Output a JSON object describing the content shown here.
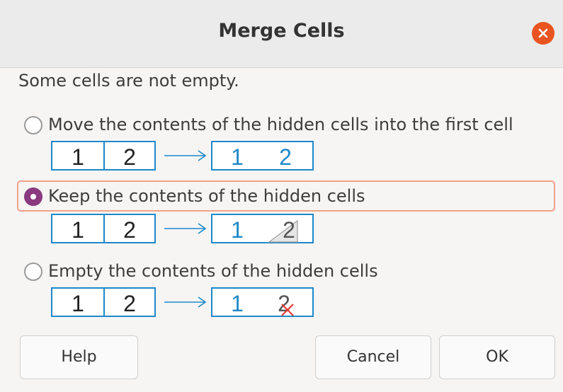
{
  "window": {
    "title": "Merge Cells",
    "close_icon": "close-icon"
  },
  "message": "Some cells are not empty.",
  "options": [
    {
      "label": "Move the contents of the hidden cells into the first cell",
      "checked": false,
      "diagram": {
        "left": [
          "1",
          "2"
        ],
        "right": [
          "1",
          "2"
        ],
        "style": "move"
      }
    },
    {
      "label": "Keep the contents of the hidden cells",
      "checked": true,
      "diagram": {
        "left": [
          "1",
          "2"
        ],
        "right": [
          "1",
          "2"
        ],
        "style": "keep"
      }
    },
    {
      "label": "Empty the contents of the hidden cells",
      "checked": false,
      "diagram": {
        "left": [
          "1",
          "2"
        ],
        "right": [
          "1",
          "2"
        ],
        "style": "empty"
      }
    }
  ],
  "buttons": {
    "help": "Help",
    "cancel": "Cancel",
    "ok": "OK"
  },
  "colors": {
    "accent": "#e95420",
    "radio_checked": "#8a3a7e",
    "diagram_blue": "#1e88c9",
    "delete_red": "#e53935"
  }
}
